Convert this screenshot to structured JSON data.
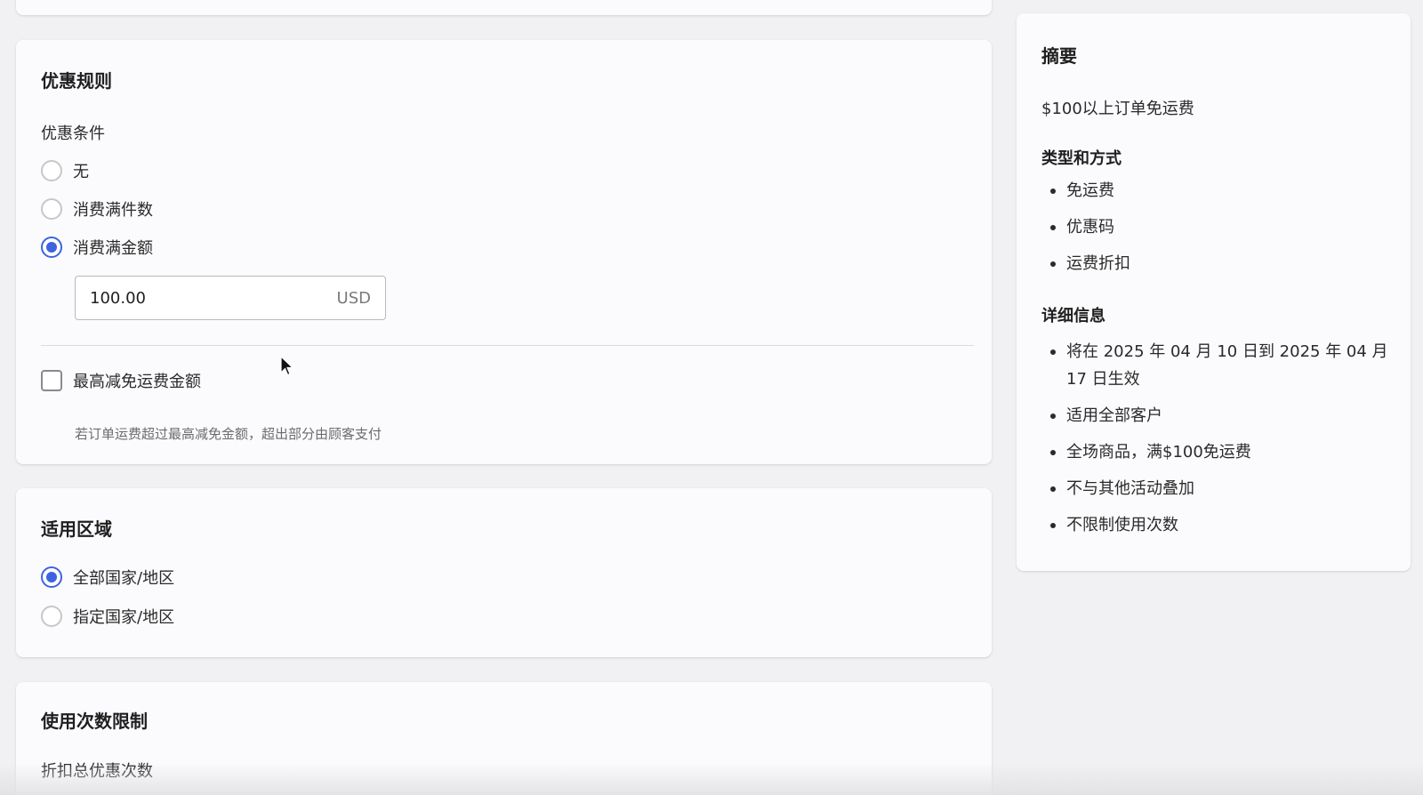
{
  "rules": {
    "title": "优惠规则",
    "condition_label": "优惠条件",
    "options": [
      {
        "label": "无",
        "checked": false
      },
      {
        "label": "消费满件数",
        "checked": false
      },
      {
        "label": "消费满金额",
        "checked": true
      }
    ],
    "amount": {
      "value": "100.00",
      "currency": "USD"
    },
    "max_discount": {
      "label": "最高减免运费金额",
      "checked": false
    },
    "max_discount_help": "若订单运费超过最高减免金额，超出部分由顾客支付"
  },
  "region": {
    "title": "适用区域",
    "options": [
      {
        "label": "全部国家/地区",
        "checked": true
      },
      {
        "label": "指定国家/地区",
        "checked": false
      }
    ]
  },
  "usage": {
    "title": "使用次数限制",
    "total_label": "折扣总优惠次数"
  },
  "summary": {
    "title": "摘要",
    "headline": "$100以上订单免运费",
    "type_title": "类型和方式",
    "type_items": [
      "免运费",
      "优惠码",
      "运费折扣"
    ],
    "detail_title": "详细信息",
    "detail_items": [
      "将在 2025 年 04 月 10 日到 2025 年 04 月 17 日生效",
      "适用全部客户",
      "全场商品，满$100免运费",
      "不与其他活动叠加",
      "不限制使用次数"
    ]
  },
  "colors": {
    "accent": "#3d63e0",
    "card_background": "#fbfbfd",
    "page_background": "#f1f1f3"
  },
  "icons": {
    "cursor": "mouse-pointer-icon"
  }
}
